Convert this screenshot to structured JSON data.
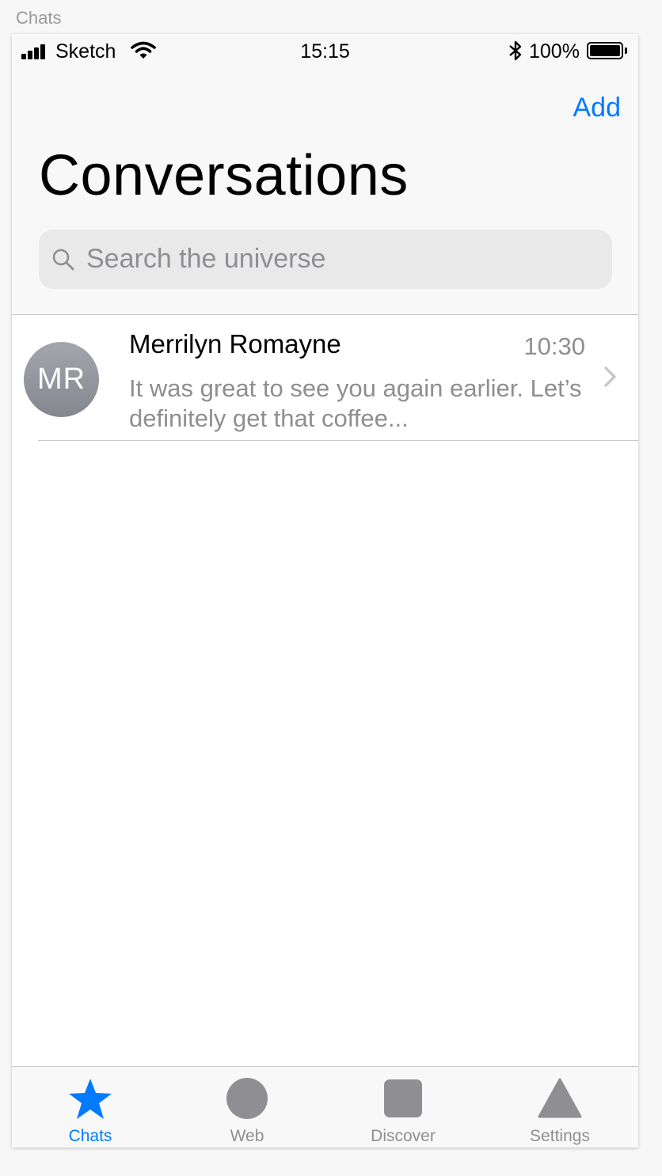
{
  "artboard": {
    "label": "Chats"
  },
  "status_bar": {
    "carrier": "Sketch",
    "time": "15:15",
    "battery": "100%",
    "icons": [
      "signal-icon",
      "wifi-icon",
      "bluetooth-icon",
      "battery-icon"
    ]
  },
  "nav": {
    "add_label": "Add",
    "title": "Conversations"
  },
  "search": {
    "placeholder": "Search the universe",
    "value": "",
    "icon": "search-icon"
  },
  "conversations": [
    {
      "initials": "MR",
      "name": "Merrilyn Romayne",
      "time": "10:30",
      "preview": "It was great to see you again earlier. Let’s definitely get that coffee..."
    }
  ],
  "tabs": [
    {
      "label": "Chats",
      "icon": "star-icon",
      "active": true
    },
    {
      "label": "Web",
      "icon": "circle-icon",
      "active": false
    },
    {
      "label": "Discover",
      "icon": "square-icon",
      "active": false
    },
    {
      "label": "Settings",
      "icon": "triangle-icon",
      "active": false
    }
  ],
  "colors": {
    "accent": "#007aff",
    "secondary_text": "#8e8e93",
    "inactive_icon": "#8e8e93",
    "bar_background": "#f8f8f8"
  }
}
